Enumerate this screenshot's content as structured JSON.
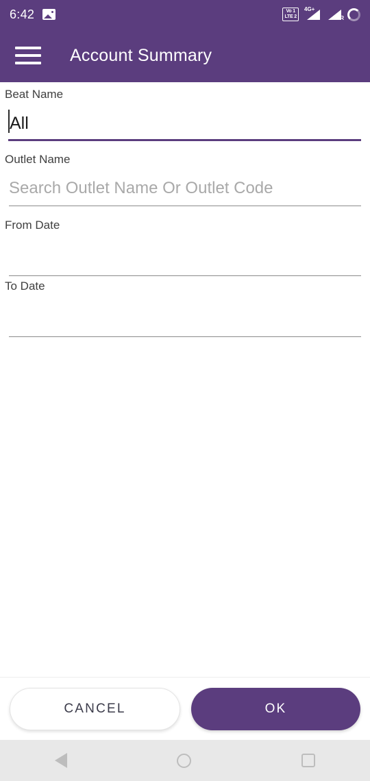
{
  "statusbar": {
    "time": "6:42",
    "notification_icon": "image-icon",
    "volte_line1": "Vo 1",
    "volte_line2": "LTE 2",
    "signal1_label": "4G+",
    "signal2_label": "R",
    "battery_icon": "battery-ring-icon"
  },
  "appbar": {
    "menu_icon": "hamburger-menu-icon",
    "title": "Account Summary",
    "background_color": "#5B3D7E"
  },
  "form": {
    "fields": [
      {
        "label": "Beat Name",
        "value": "All",
        "placeholder": "",
        "focused": true
      },
      {
        "label": "Outlet Name",
        "value": "",
        "placeholder": "Search Outlet Name Or Outlet Code",
        "focused": false
      },
      {
        "label": "From Date",
        "value": "",
        "placeholder": "",
        "focused": false
      },
      {
        "label": "To Date",
        "value": "",
        "placeholder": "",
        "focused": false
      }
    ]
  },
  "actions": {
    "cancel_label": "CANCEL",
    "ok_label": "OK",
    "accent_color": "#5B3D7E"
  },
  "navbar": {
    "back_icon": "back-triangle-icon",
    "home_icon": "home-circle-icon",
    "recents_icon": "recents-square-icon"
  }
}
